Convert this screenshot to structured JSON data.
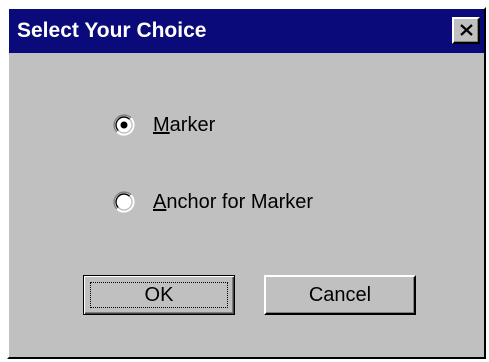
{
  "dialog": {
    "title": "Select Your Choice",
    "close_icon": "close-icon"
  },
  "options": [
    {
      "mnemonic": "M",
      "rest": "arker",
      "selected": true
    },
    {
      "mnemonic": "A",
      "rest": "nchor for Marker",
      "selected": false
    }
  ],
  "buttons": {
    "ok_label": "OK",
    "cancel_label": "Cancel"
  },
  "colors": {
    "titlebar": "#0a0a7a",
    "face": "#c0c0c0"
  }
}
